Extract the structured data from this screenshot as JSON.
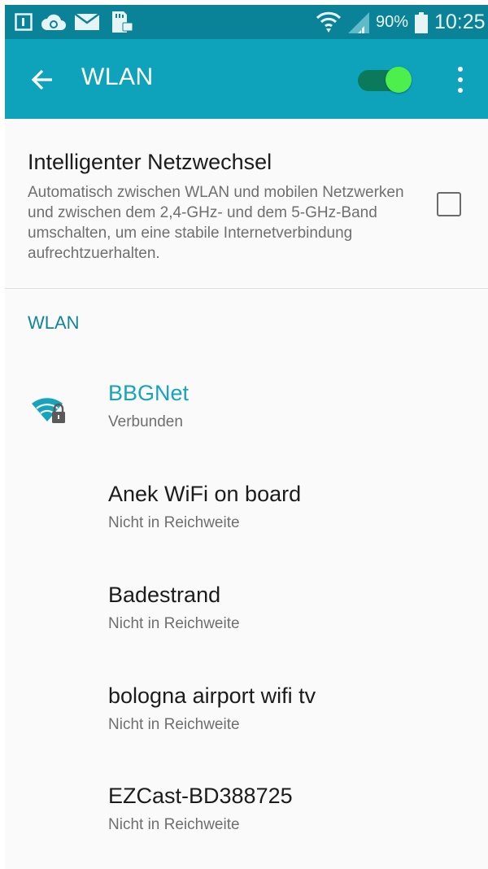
{
  "status_bar": {
    "battery_percent": "90%",
    "time": "10:25",
    "icons": [
      "notification-square-icon",
      "cloud-sync-icon",
      "mail-icon",
      "sd-card-icon",
      "wifi-icon",
      "cell-signal-icon",
      "battery-icon"
    ]
  },
  "app_bar": {
    "title": "WLAN",
    "back_icon": "arrow-left-icon",
    "wlan_enabled": true,
    "more_icon": "more-vert-icon"
  },
  "smart_switch": {
    "title": "Intelligenter Netzwechsel",
    "description": "Automatisch zwischen WLAN und mobilen Netzwerken und zwischen dem 2,4-GHz- und dem 5-GHz-Band umschalten, um eine stabile Internetverbindung aufrechtzuerhalten.",
    "checked": false
  },
  "section_title": "WLAN",
  "networks": [
    {
      "name": "BBGNet",
      "status": "Verbunden",
      "connected": true,
      "icon": "wifi-lock-icon"
    },
    {
      "name": "Anek WiFi on board",
      "status": "Nicht in Reichweite",
      "connected": false
    },
    {
      "name": "Badestrand",
      "status": "Nicht in Reichweite",
      "connected": false
    },
    {
      "name": "bologna airport wifi tv",
      "status": "Nicht in Reichweite",
      "connected": false
    },
    {
      "name": "EZCast-BD388725",
      "status": "Nicht in Reichweite",
      "connected": false
    }
  ],
  "colors": {
    "status_bar": "#0a8399",
    "app_bar": "#0ea3bb",
    "accent": "#17a3bb",
    "toggle_thumb": "#4cef4c"
  }
}
